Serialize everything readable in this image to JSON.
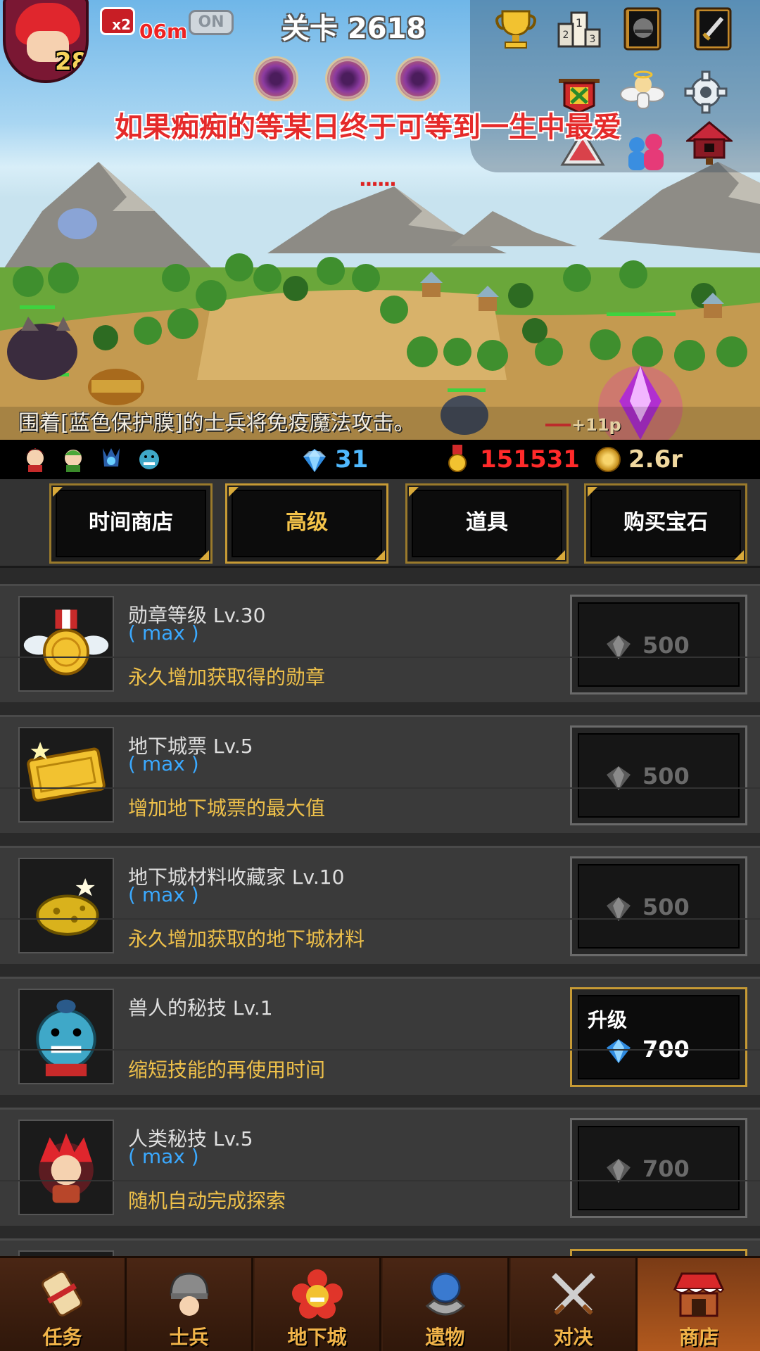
{
  "player": {
    "level": "28"
  },
  "hud": {
    "speed_label": "x2",
    "speed_time": "06m",
    "toggle": "ON",
    "stage": "关卡 2618",
    "marquee": "如果痴痴的等某日终于可等到一生中最爱",
    "loading_dots": "......"
  },
  "battle": {
    "notice": "围着[蓝色保护膜]的士兵将免疫魔法攻击。",
    "damage_text": "+11p"
  },
  "resources": {
    "gems": "31",
    "medals": "151531",
    "coins": "2.6r"
  },
  "tabs": [
    {
      "label": "时间商店",
      "active": false
    },
    {
      "label": "高级",
      "active": true
    },
    {
      "label": "道具",
      "active": false
    },
    {
      "label": "购买宝石",
      "active": false
    }
  ],
  "items": [
    {
      "title": "勋章等级 Lv.30",
      "max": "( max )",
      "desc": "永久增加获取得的勋章",
      "price": "500",
      "button": "",
      "icon": "medal-icon",
      "enabled": false
    },
    {
      "title": "地下城票 Lv.5",
      "max": "( max )",
      "desc": "增加地下城票的最大值",
      "price": "500",
      "button": "",
      "icon": "ticket-icon",
      "enabled": false
    },
    {
      "title": "地下城材料收藏家 Lv.10",
      "max": "( max )",
      "desc": "永久增加获取的地下城材料",
      "price": "500",
      "button": "",
      "icon": "gold-ore-icon",
      "enabled": false
    },
    {
      "title": "兽人的秘技 Lv.1",
      "max": "",
      "desc": "缩短技能的再使用时间",
      "price": "700",
      "button": "升级",
      "icon": "orc-icon",
      "enabled": true
    },
    {
      "title": "人类秘技 Lv.5",
      "max": "( max )",
      "desc": "随机自动完成探索",
      "price": "700",
      "button": "",
      "icon": "human-icon",
      "enabled": false
    }
  ],
  "nav": [
    {
      "label": "任务",
      "icon": "scroll-icon",
      "active": false
    },
    {
      "label": "士兵",
      "icon": "soldier-helmet-icon",
      "active": false
    },
    {
      "label": "地下城",
      "icon": "dungeon-flower-icon",
      "active": false
    },
    {
      "label": "遗物",
      "icon": "relic-orb-icon",
      "active": false
    },
    {
      "label": "对决",
      "icon": "crossed-swords-icon",
      "active": false
    },
    {
      "label": "商店",
      "icon": "shop-icon",
      "active": true
    }
  ],
  "colors": {
    "gem_blue": "#4fb9ff",
    "medal_red": "#ff2a2a",
    "gold": "#eec04a",
    "max_blue": "#3aa9ff"
  }
}
